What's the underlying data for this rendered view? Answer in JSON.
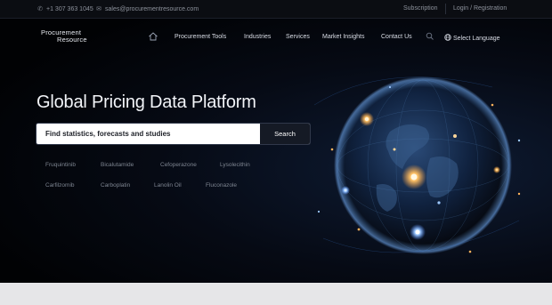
{
  "topbar": {
    "phone": "+1 307 363 1045",
    "email": "sales@procurementresource.com",
    "subscription": "Subscription",
    "login": "Login / Registration"
  },
  "logo": {
    "line1": "Procurement",
    "line2": "Resource"
  },
  "nav": {
    "items": [
      {
        "label": "Procurement Tools"
      },
      {
        "label": "Industries"
      },
      {
        "label": "Services"
      },
      {
        "label": "Market Insights"
      },
      {
        "label": "Contact Us"
      }
    ],
    "language": "Select Language"
  },
  "hero": {
    "title": "Global Pricing Data Platform",
    "search_placeholder": "Find statistics, forecasts and studies",
    "search_button": "Search"
  },
  "suggestions": [
    "Fruquintinib",
    "Bicalutamide",
    "Cefoperazone",
    "Lysolecithin",
    "Carfilzomib",
    "Carboplatin",
    "Lanolin Oil",
    "Fluconazole"
  ],
  "colors": {
    "background": "#02040a",
    "globe_glow": "#ffb347",
    "search_button": "#151a25",
    "bottom_band": "#e6e6e8"
  },
  "icons": [
    "phone-icon",
    "email-icon",
    "home-icon",
    "search-icon",
    "globe-language-icon"
  ]
}
